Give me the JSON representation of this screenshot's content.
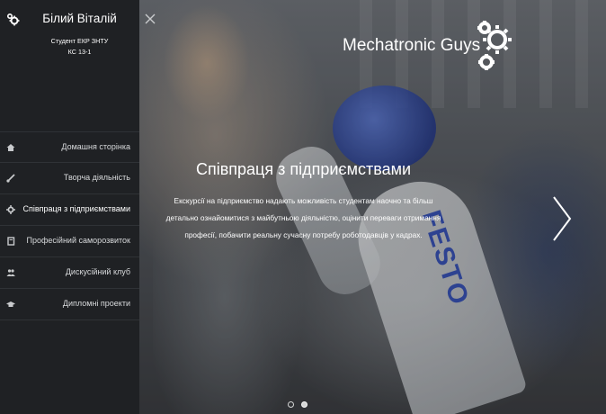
{
  "profile": {
    "name": "Білий Віталій",
    "role": "Студент ЕКР ЗНТУ",
    "group": "КС 13-1",
    "icon": "gears-icon"
  },
  "nav": {
    "items": [
      {
        "label": "Домашня сторінка",
        "icon": "home-icon"
      },
      {
        "label": "Творча діяльність",
        "icon": "brush-icon"
      },
      {
        "label": "Співпраця з підприємствами",
        "icon": "gear-icon",
        "active": true
      },
      {
        "label": "Професійний саморозвиток",
        "icon": "book-icon"
      },
      {
        "label": "Дискусійний клуб",
        "icon": "users-icon"
      },
      {
        "label": "Дипломні проекти",
        "icon": "graduation-cap-icon"
      }
    ]
  },
  "brand": {
    "title": "Mechatronic Guys",
    "icon": "gears-icon"
  },
  "slide": {
    "title": "Співпраця з підприємствами",
    "text": "Екскурсії на підприємство надають можливість студентам наочно та більш детально ознайомитися з майбутньою діяльністю, оцінити переваги отримання професії, побачити реальну сучасну потребу роботодавців у кадрах.",
    "image_text": "FESTO",
    "slide_count": 2,
    "active_index": 1
  },
  "colors": {
    "sidebar_bg": "#1f2124",
    "nav_text": "#d8dadc",
    "festo_blue": "#2a46b0"
  }
}
